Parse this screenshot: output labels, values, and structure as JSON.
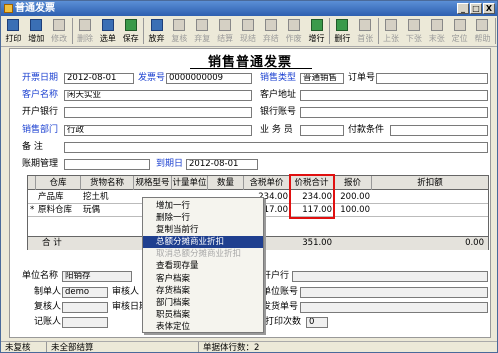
{
  "window": {
    "title": "普通发票",
    "buttons": [
      "_",
      "□",
      "X"
    ]
  },
  "toolbar": [
    {
      "label": "打印",
      "state": "on"
    },
    {
      "label": "增加",
      "state": "on"
    },
    {
      "label": "修改",
      "state": "off"
    },
    {
      "label": "删除",
      "state": "off"
    },
    {
      "label": "选单",
      "state": "on"
    },
    {
      "label": "保存",
      "state": "on"
    },
    {
      "label": "放弃",
      "state": "on"
    },
    {
      "label": "复核",
      "state": "off"
    },
    {
      "label": "弃复",
      "state": "off"
    },
    {
      "label": "结算",
      "state": "off"
    },
    {
      "label": "现结",
      "state": "off"
    },
    {
      "label": "弃结",
      "state": "off"
    },
    {
      "label": "作废",
      "state": "off"
    },
    {
      "label": "增行",
      "state": "on"
    },
    {
      "label": "删行",
      "state": "on"
    },
    {
      "label": "首张",
      "state": "off"
    },
    {
      "label": "上张",
      "state": "off"
    },
    {
      "label": "下张",
      "state": "off"
    },
    {
      "label": "末张",
      "state": "off"
    },
    {
      "label": "定位",
      "state": "off"
    },
    {
      "label": "帮助",
      "state": "off"
    }
  ],
  "form": {
    "title": "销售普通发票",
    "invoice_date_label": "开票日期",
    "invoice_date": "2012-08-01",
    "invoice_no_label": "发票号",
    "invoice_no": "0000000009",
    "sales_type_label": "销售类型",
    "sales_type": "普通销售",
    "order_no_label": "订单号",
    "order_no": "",
    "customer_label": "客户名称",
    "customer": "闲天实业",
    "customer_addr_label": "客户地址",
    "customer_addr": "",
    "bank_label": "开户银行",
    "bank": "",
    "account_label": "银行账号",
    "account": "",
    "dept_label": "销售部门",
    "dept": "行政",
    "salesman_label": "业 务 员",
    "salesman": "",
    "terms_label": "付款条件",
    "terms": "",
    "note_label": "备   注",
    "note": "",
    "acct_mgmt_label": "账期管理",
    "acct_mgmt": "",
    "due_date_label": "到期日",
    "due_date": "2012-08-01",
    "unit_name_label": "单位名称",
    "unit_name": "阳销存",
    "bank2_label": "开户行",
    "bank2": "",
    "maker_label": "制单人",
    "maker": "demo",
    "reviewer_label": "审核人",
    "reviewer": "",
    "unit_account_label": "单位账号",
    "unit_account": "",
    "rechecker_label": "复核人",
    "rechecker": "",
    "review_date_label": "审核日期",
    "review_date": "",
    "ship_no_label": "发货单号",
    "ship_no": "",
    "bookkeeper_label": "记账人",
    "bookkeeper": "",
    "print_count_label": "已打印次数",
    "print_count": "0"
  },
  "grid": {
    "headers": [
      "仓库",
      "货物名称",
      "规格型号",
      "计量单位",
      "数量",
      "含税单价",
      "价税合计",
      "报价",
      "折扣额"
    ],
    "rows": [
      {
        "marker": "",
        "warehouse": "产品库",
        "item": "挖土机",
        "qty": "",
        "price": "234.00",
        "total": "234.00",
        "quote": "200.00"
      },
      {
        "marker": "*",
        "warehouse": "原料仓库",
        "item": "玩偶",
        "qty": "",
        "price": "117.00",
        "total": "117.00",
        "quote": "100.00"
      }
    ],
    "total_label": "合  计",
    "total_value": "351.00",
    "discount_total": "0.00"
  },
  "context_menu": {
    "items": [
      {
        "label": "增加一行",
        "state": "normal"
      },
      {
        "label": "删除一行",
        "state": "normal"
      },
      {
        "label": "复制当前行",
        "state": "normal"
      },
      {
        "label": "总额分摊商业折扣",
        "state": "highlight"
      },
      {
        "label": "取消总额分摊商业折扣",
        "state": "disabled"
      },
      {
        "label": "查看现存量",
        "state": "normal"
      },
      {
        "label": "客户档案",
        "state": "normal"
      },
      {
        "label": "存货档案",
        "state": "normal"
      },
      {
        "label": "部门档案",
        "state": "normal"
      },
      {
        "label": "职员档案",
        "state": "normal"
      },
      {
        "label": "表体定位",
        "state": "normal"
      }
    ]
  },
  "status": {
    "left": "未复核",
    "mid": "未全部结算",
    "right": "单据体行数：2"
  },
  "colors": {
    "accent": "#1a3fd0",
    "highlight": "#1f3f8f",
    "red_box": "#e01010"
  }
}
